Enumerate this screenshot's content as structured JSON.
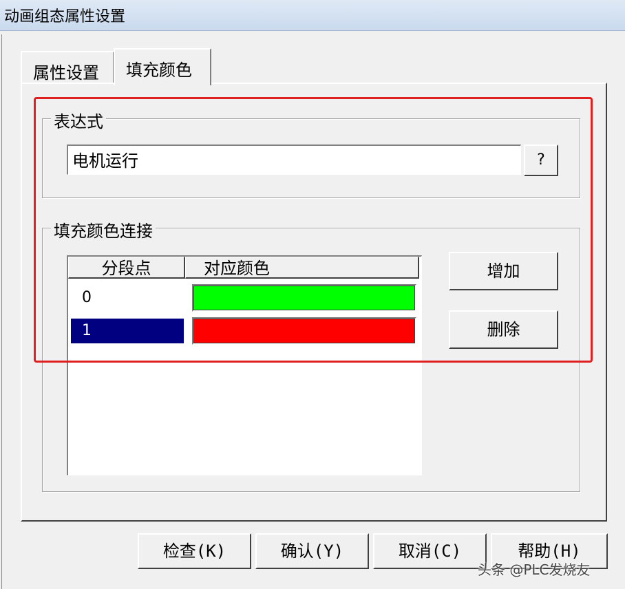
{
  "window": {
    "title": "动画组态属性设置"
  },
  "tabs": [
    {
      "label": "属性设置",
      "active": false
    },
    {
      "label": "填充颜色",
      "active": true
    }
  ],
  "expression_group": {
    "legend": "表达式",
    "value": "电机运行",
    "help_button": "?"
  },
  "fill_color_group": {
    "legend": "填充颜色连接",
    "columns": [
      "分段点",
      "对应颜色"
    ],
    "rows": [
      {
        "point": "0",
        "color": "#00ff00",
        "selected": false
      },
      {
        "point": "1",
        "color": "#ff0000",
        "selected": true
      }
    ],
    "add_button": "增加",
    "delete_button": "删除"
  },
  "footer": {
    "check": "检查(K)",
    "ok": "确认(Y)",
    "cancel": "取消(C)",
    "help": "帮助(H)"
  },
  "watermark": "头条 @PLC发烧友",
  "colors": {
    "highlight": "#e02020",
    "selection": "#000080"
  }
}
